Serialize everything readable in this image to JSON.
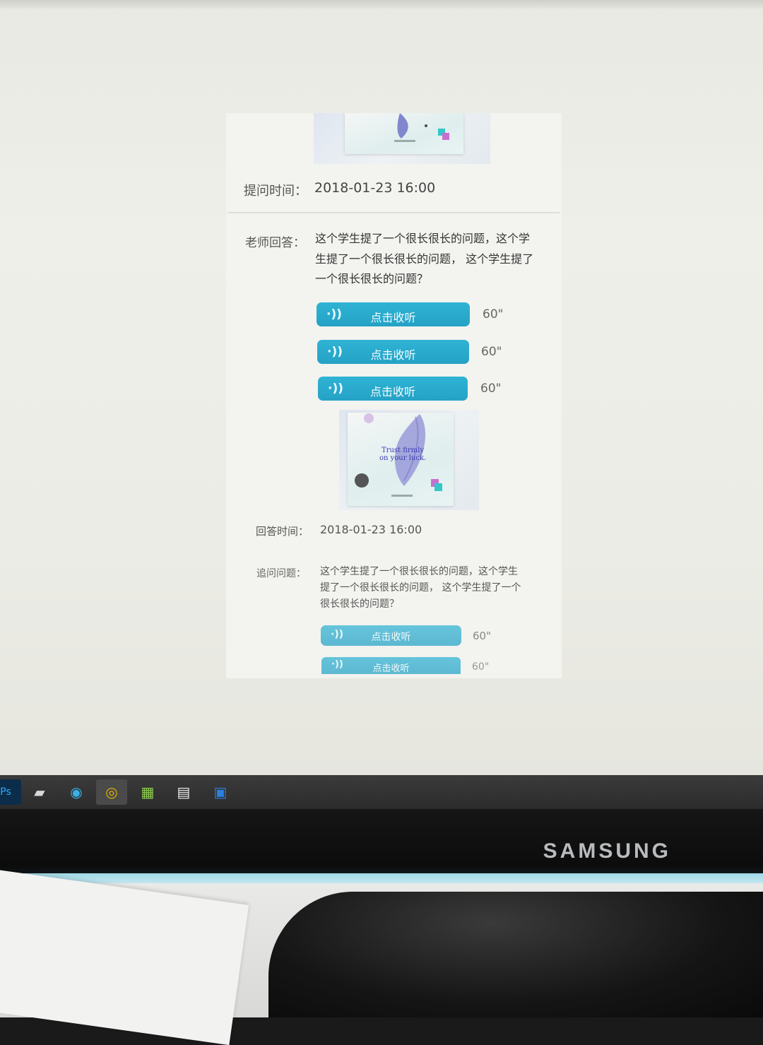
{
  "question": {
    "time_label": "提问时间：",
    "time_value": "2018-01-23 16:00"
  },
  "teacher_answer": {
    "label": "老师回答：",
    "text": "这个学生提了一个很长很长的问题，这个学生提了一个很长很长的问题， 这个学生提了一个很长很长的问题？",
    "audio": [
      {
        "label": "点击收听",
        "duration": "60\""
      },
      {
        "label": "点击收听",
        "duration": "60\""
      },
      {
        "label": "点击收听",
        "duration": "60\""
      }
    ],
    "image_text": [
      "Trust firmly",
      "on your luck."
    ],
    "time_label": "回答时间：",
    "time_value": "2018-01-23 16:00"
  },
  "followup": {
    "label": "追问问题：",
    "text": "这个学生提了一个很长很长的问题，这个学生提了一个很长很长的问题， 这个学生提了一个很长很长的问题？",
    "audio": [
      {
        "label": "点击收听",
        "duration": "60\""
      },
      {
        "label": "点击收听",
        "duration": "60\""
      }
    ]
  },
  "monitor": {
    "brand": "SAMSUNG"
  },
  "colors": {
    "button": "#2aaacc",
    "screen_bg": "#eeeee8"
  }
}
